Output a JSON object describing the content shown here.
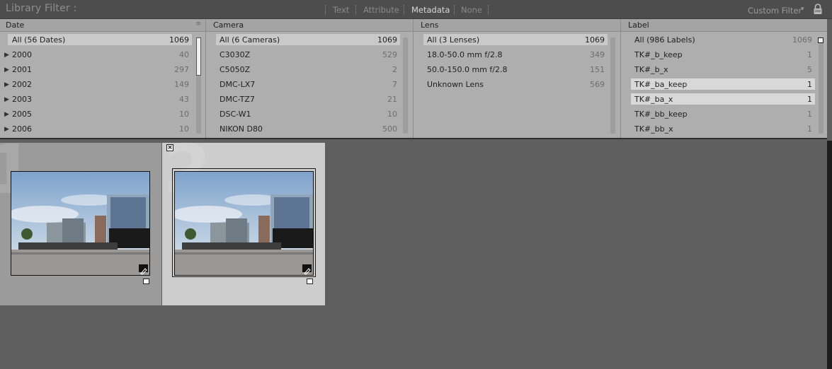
{
  "filter_bar": {
    "title": "Library Filter :",
    "modes": [
      "Text",
      "Attribute",
      "Metadata",
      "None"
    ],
    "active_mode": "Metadata",
    "preset": "Custom Filter"
  },
  "columns": {
    "date": {
      "header": "Date",
      "rows": [
        {
          "label": "All (56 Dates)",
          "count": "1069"
        },
        {
          "label": "2000",
          "count": "40"
        },
        {
          "label": "2001",
          "count": "297"
        },
        {
          "label": "2002",
          "count": "149"
        },
        {
          "label": "2003",
          "count": "43"
        },
        {
          "label": "2005",
          "count": "10"
        },
        {
          "label": "2006",
          "count": "10"
        }
      ]
    },
    "camera": {
      "header": "Camera",
      "rows": [
        {
          "label": "All (6 Cameras)",
          "count": "1069"
        },
        {
          "label": "C3030Z",
          "count": "529"
        },
        {
          "label": "C5050Z",
          "count": "2"
        },
        {
          "label": "DMC-LX7",
          "count": "7"
        },
        {
          "label": "DMC-TZ7",
          "count": "21"
        },
        {
          "label": "DSC-W1",
          "count": "10"
        },
        {
          "label": "NIKON D80",
          "count": "500"
        }
      ]
    },
    "lens": {
      "header": "Lens",
      "rows": [
        {
          "label": "All (3 Lenses)",
          "count": "1069"
        },
        {
          "label": "18.0-50.0 mm f/2.8",
          "count": "349"
        },
        {
          "label": "50.0-150.0 mm f/2.8",
          "count": "151"
        },
        {
          "label": "Unknown Lens",
          "count": "569"
        }
      ]
    },
    "label": {
      "header": "Label",
      "rows": [
        {
          "label": "All (986 Labels)",
          "count": "1069"
        },
        {
          "label": "TK#_b_keep",
          "count": "1"
        },
        {
          "label": "TK#_b_x",
          "count": "5"
        },
        {
          "label": "TK#_ba_keep",
          "count": "1"
        },
        {
          "label": "TK#_ba_x",
          "count": "1"
        },
        {
          "label": "TK#_bb_keep",
          "count": "1"
        },
        {
          "label": "TK#_bb_x",
          "count": "1"
        }
      ]
    }
  },
  "grid": {
    "cells": [
      {
        "index": "1"
      },
      {
        "index": "2"
      }
    ]
  },
  "colors": {
    "filter_bar_bg": "#4d4d4d",
    "browser_bg": "#aeaeae",
    "grid_bg": "#5f5f5f",
    "selected_cell_bg": "#cdcdcd"
  },
  "icons": [
    "sort-icon",
    "disclosure-triangle-icon",
    "lock-icon",
    "dropdown-arrow-icon",
    "metadata-badge-icon",
    "flag-reject-icon",
    "check-box-icon"
  ]
}
